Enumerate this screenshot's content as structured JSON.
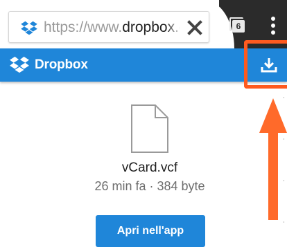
{
  "browser": {
    "url_scheme": "https://www.",
    "url_host": "dropbox.com",
    "url_rest": "/",
    "tab_count": "6",
    "icons": {
      "site": "dropbox-icon",
      "clear": "close-icon",
      "tabs": "tabs-icon",
      "menu": "more-vert-icon"
    },
    "colors": {
      "toolbar_dark": "#2b2b2b"
    }
  },
  "header": {
    "brand": "Dropbox",
    "download_icon": "download-icon",
    "colors": {
      "brand_blue": "#1f86d9"
    }
  },
  "file": {
    "icon": "file-icon",
    "name": "vCard.vcf",
    "age": "26 min fa",
    "separator": "·",
    "size": "384 byte"
  },
  "actions": {
    "open_label": "Apri nell'app"
  },
  "annotation": {
    "highlight_color": "#ff5a1f",
    "arrow_color": "#ff6a2a"
  }
}
